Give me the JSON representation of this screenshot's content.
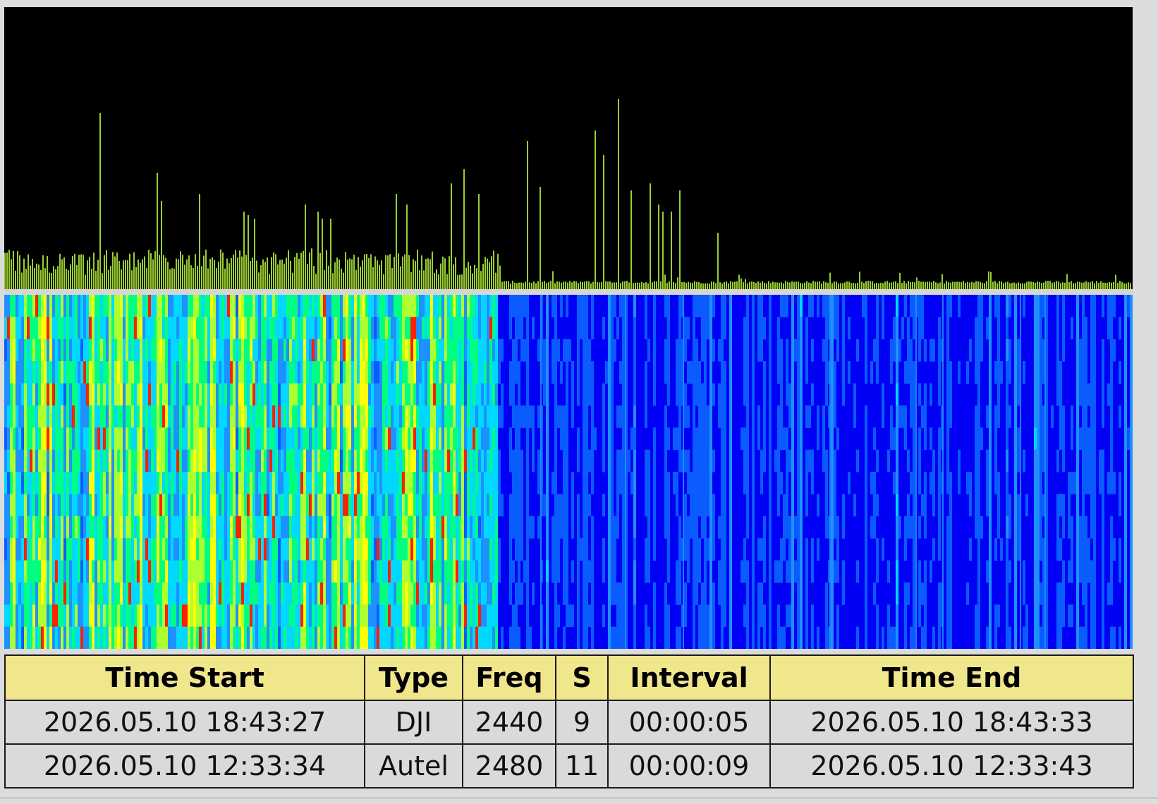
{
  "colors": {
    "spectrum_background": "#000000",
    "spectrum_bar": "#9acd32",
    "waterfall_quiet": "#0000f5",
    "waterfall_scale": [
      "#0000f5",
      "#0a5cff",
      "#1e90ff",
      "#00d8ff",
      "#00ff80",
      "#adff2f",
      "#ffff00",
      "#ff2000"
    ],
    "table_header_background": "#f0e68c",
    "table_row_background": "#dadada"
  },
  "detections_table": {
    "columns": [
      "Time Start",
      "Type",
      "Freq",
      "S",
      "Interval",
      "Time End"
    ],
    "rows": [
      {
        "time_start": "2026.05.10 18:43:27",
        "type": "DJI",
        "freq": "2440",
        "s": "9",
        "interval": "00:00:05",
        "time_end": "2026.05.10 18:43:33"
      },
      {
        "time_start": "2026.05.10 12:33:34",
        "type": "Autel",
        "freq": "2480",
        "s": "11",
        "interval": "00:00:09",
        "time_end": "2026.05.10 12:33:43"
      }
    ]
  }
}
